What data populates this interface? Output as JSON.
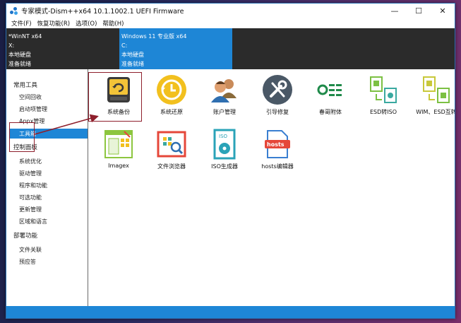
{
  "window": {
    "title": "专家模式-Dism++x64 10.1.1002.1 UEFI Firmware",
    "controls": {
      "minimize": "—",
      "maximize": "☐",
      "close": "✕"
    }
  },
  "menu": [
    "文件(F)",
    "恢复功能(R)",
    "选项(O)",
    "帮助(H)"
  ],
  "images": [
    {
      "name": "*WinNT x64",
      "drive": "X:",
      "type": "本地硬盘",
      "status": "准备就绪"
    },
    {
      "name": "Windows 11 专业版 x64",
      "drive": "C:",
      "type": "本地硬盘",
      "status": "准备就绪"
    }
  ],
  "sidebar": {
    "groups": [
      {
        "title": "常用工具",
        "items": [
          "空间回收",
          "启动项管理",
          "Appx管理",
          "工具箱"
        ]
      },
      {
        "title": "控制面板",
        "items": [
          "系统优化",
          "驱动管理",
          "程序和功能",
          "可选功能",
          "更新管理",
          "区域和语言"
        ]
      },
      {
        "title": "部署功能",
        "items": [
          "文件关联",
          "预应答"
        ]
      }
    ],
    "active": "工具箱"
  },
  "tools": [
    {
      "label": "系统备份",
      "icon": "backup-drive-icon"
    },
    {
      "label": "系统还原",
      "icon": "restore-clock-icon"
    },
    {
      "label": "账户管理",
      "icon": "users-icon"
    },
    {
      "label": "引导修复",
      "icon": "wrench-screwdriver-icon"
    },
    {
      "label": "春哥附体",
      "icon": "admin-toggle-icon"
    },
    {
      "label": "ESD转ISO",
      "icon": "esd-convert-icon"
    },
    {
      "label": "WIM、ESD互转",
      "icon": "wim-esd-convert-icon"
    },
    {
      "label": "Imagex",
      "icon": "imagex-icon"
    },
    {
      "label": "文件浏览器",
      "icon": "file-browser-icon"
    },
    {
      "label": "ISO生成器",
      "icon": "iso-disc-icon"
    },
    {
      "label": "hosts编辑器",
      "icon": "hosts-file-icon"
    }
  ],
  "colors": {
    "accent": "#1e86d6",
    "annotation": "#8e1f2c",
    "image_bar": "#2b2b2b"
  }
}
